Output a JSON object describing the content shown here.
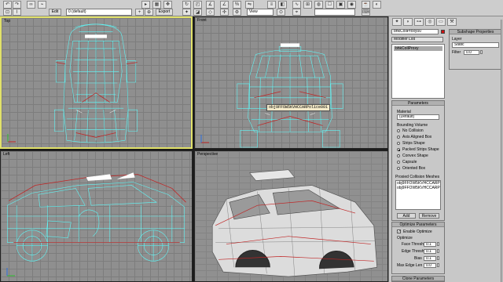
{
  "colors": {
    "active_border": "#e2e26a",
    "object_color": "#d01010",
    "wire_cyan": "#5ff7f7",
    "wire_red": "#c02525"
  },
  "toolbar": {
    "edit_label": "Edit",
    "layer_value": "0 (default)",
    "export_label": "Export",
    "view_value": "View"
  },
  "viewports": {
    "top": {
      "label": "Top"
    },
    "front": {
      "label": "Front",
      "object_tag": "obj9FFOW5KVHCCARPolice001"
    },
    "left": {
      "label": "Left"
    },
    "perspective": {
      "label": "Perspective"
    }
  },
  "command_panel": {
    "object_name": "bhkCollProxy00",
    "modifier_list_label": "Modifier List",
    "stack_item": "bhkCollProxy",
    "parameters": {
      "title": "Parameters",
      "material_label": "Material",
      "material_value": "(Default)",
      "bounding_volume_label": "Bounding Volume",
      "options": [
        "No Collision",
        "Axis Aligned Box",
        "Strips Shape",
        "Packed Strips Shape",
        "Convex Shape",
        "Capsule",
        "Oriented Box"
      ],
      "selected_option": "Packed Strips Shape",
      "proxied_meshes_label": "Proxied Collision Meshes",
      "meshes": [
        "obj9FFOW5KVHCCARPolice",
        "obj9FFOW5KVHCCARPolice"
      ],
      "add_label": "Add",
      "remove_label": "Remove"
    },
    "optimize": {
      "title": "Optimize Parameters",
      "enable_label": "Enable Optimize",
      "enabled": true,
      "group_label": "Optimize",
      "face_thresh_label": "Face Thresh",
      "face_thresh_value": "0.1",
      "edge_thresh_label": "Edge Thresh",
      "edge_thresh_value": "0.1",
      "bias_label": "Bias",
      "bias_value": "0.1",
      "max_edge_label": "Max Edge Len",
      "max_edge_value": "0.0"
    },
    "clone_title": "Clone Parameters"
  },
  "subshape": {
    "title": "Subshape Properties",
    "layer_label": "Layer",
    "layer_value": "Static",
    "filter_label": "Filter",
    "filter_value": "0.0"
  }
}
